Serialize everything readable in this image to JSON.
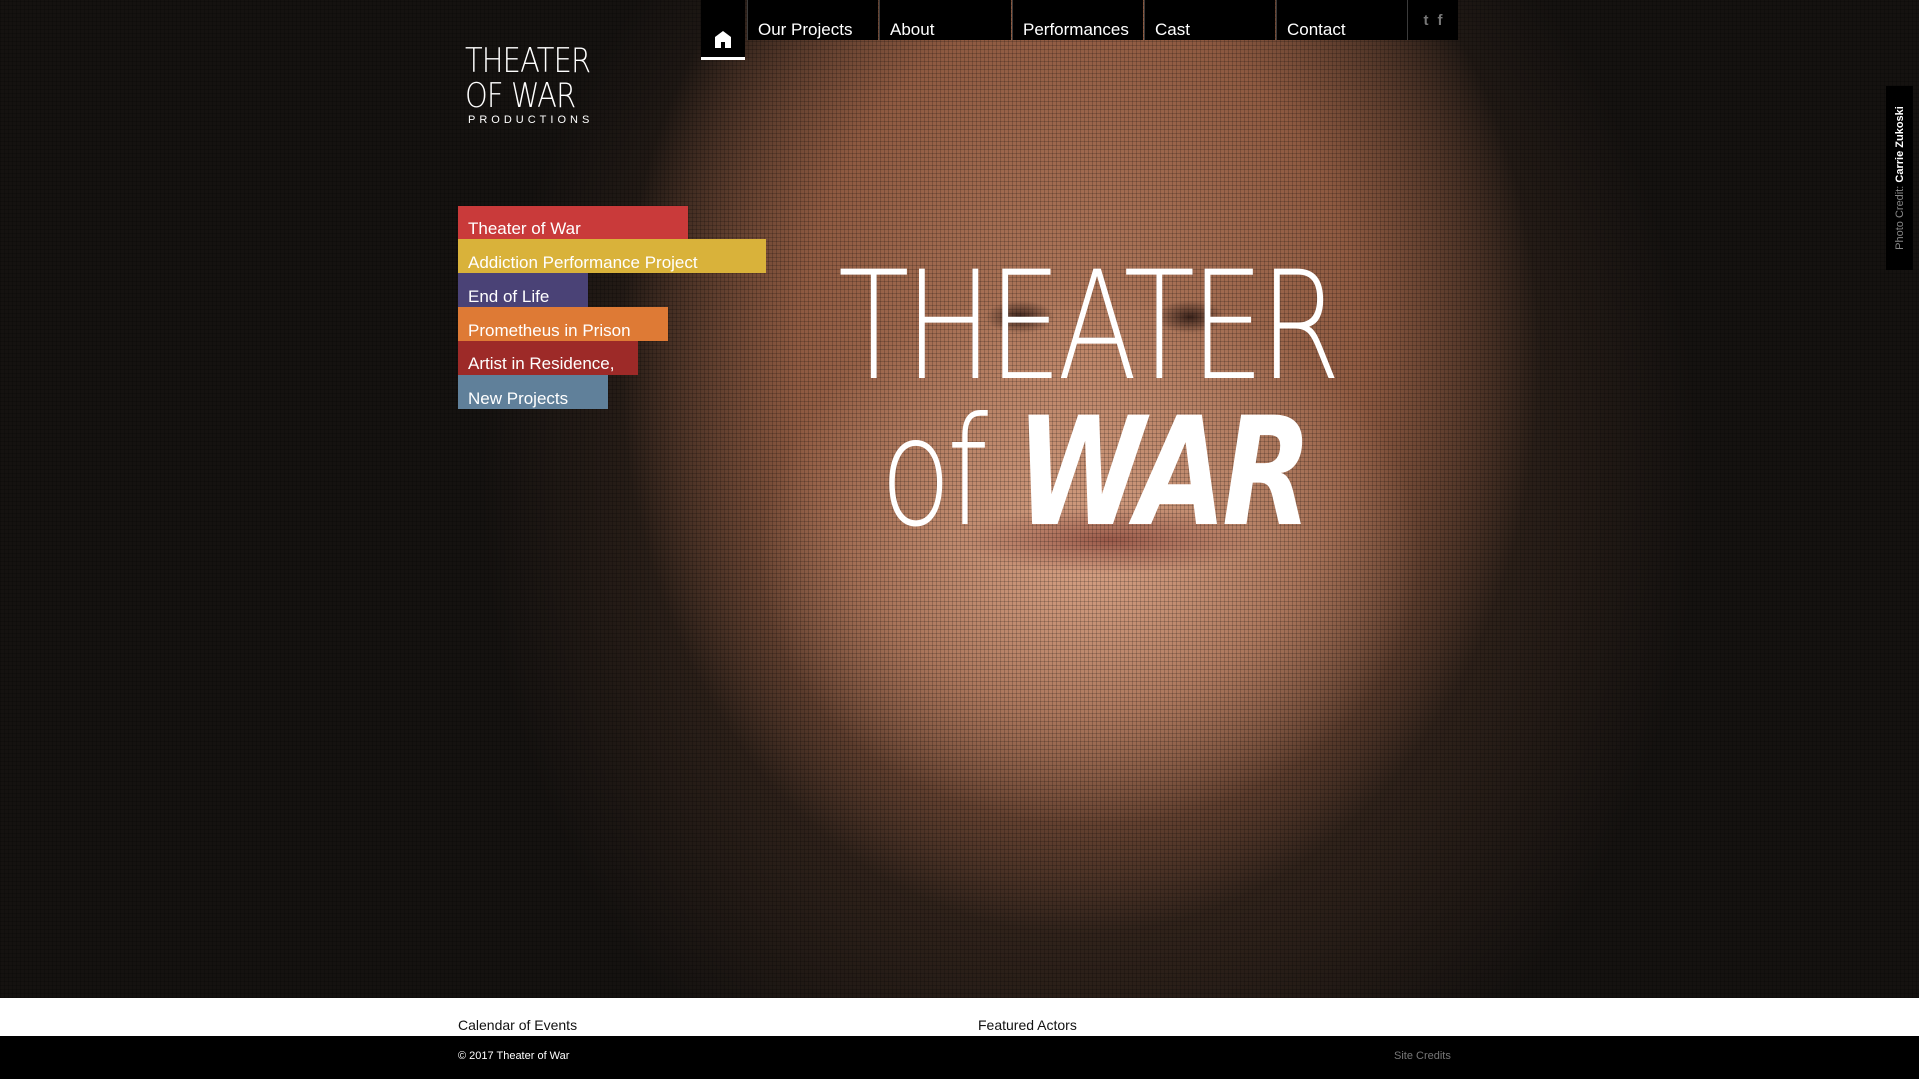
{
  "nav": {
    "items": [
      {
        "label": "Our Projects"
      },
      {
        "label": "About"
      },
      {
        "label": "Performances"
      },
      {
        "label": "Cast"
      },
      {
        "label": "Contact"
      }
    ],
    "social": {
      "twitter": "t",
      "facebook": "f"
    }
  },
  "logo": {
    "line1": "THEATER",
    "line2": "OF WAR",
    "line3": "PRODUCTIONS"
  },
  "projects": [
    {
      "label": "Theater of War",
      "color": "#c93a3a"
    },
    {
      "label": "Addiction Performance Project",
      "color": "#d9b23a"
    },
    {
      "label": "End of Life",
      "color": "#4a4276"
    },
    {
      "label": "Prometheus in Prison",
      "color": "#de7a35"
    },
    {
      "label": "Artist in Residence, NYC",
      "color": "#9d2a28"
    },
    {
      "label": "New Projects",
      "color": "#60809a"
    }
  ],
  "hero": {
    "title_line1": "THEATER",
    "title_of": "of",
    "title_war": "WAR"
  },
  "credit": {
    "prefix": "Photo Credit:",
    "name": "Carrie Zukoski"
  },
  "footer": {
    "calendar": "Calendar of Events",
    "featured": "Featured Actors",
    "copyright": "© 2017 Theater of War",
    "site_credits": "Site Credits"
  }
}
